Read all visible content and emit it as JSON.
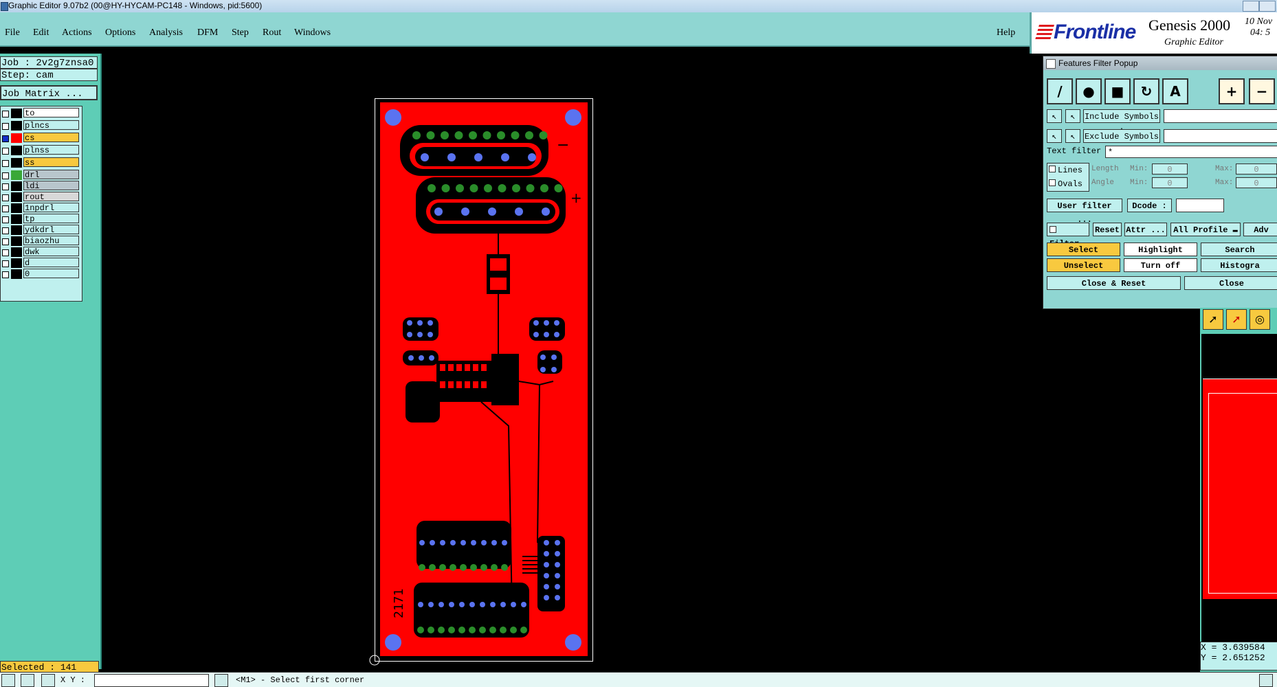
{
  "window": {
    "title": "Graphic Editor 9.07b2 (00@HY-HYCAM-PC148 - Windows, pid:5600)"
  },
  "menu": {
    "items": [
      "File",
      "Edit",
      "Actions",
      "Options",
      "Analysis",
      "DFM",
      "Step",
      "Rout",
      "Windows"
    ],
    "help": "Help"
  },
  "brand": {
    "logo": "Frontline",
    "product": "Genesis 2000",
    "subtitle": "Graphic Editor",
    "date": "10 Nov",
    "time": "04: 5"
  },
  "job": {
    "job_label": "Job : 2v2g7znsa0",
    "step_label": "Step: cam",
    "matrix_button": "Job Matrix ..."
  },
  "layers": [
    {
      "name": "to",
      "swatch": "#000000",
      "bg": "#ffffff"
    },
    {
      "name": "plncs",
      "swatch": "#000000",
      "bg": "#bff0ee"
    },
    {
      "name": "cs",
      "swatch": "#ff0000",
      "bg": "#f8c93f",
      "active": true
    },
    {
      "name": "plnss",
      "swatch": "#000000",
      "bg": "#bff0ee"
    },
    {
      "name": "ss",
      "swatch": "#000000",
      "bg": "#f8c93f"
    },
    {
      "name": "drl",
      "swatch": "#3aa837",
      "bg": "#b8c6cc"
    },
    {
      "name": "ldi",
      "swatch": "#000000",
      "bg": "#b8c6cc"
    },
    {
      "name": "rout",
      "swatch": "#000000",
      "bg": "#d8d8d8"
    },
    {
      "name": "1npdrl",
      "swatch": "#000000",
      "bg": "#bff0ee"
    },
    {
      "name": "tp",
      "swatch": "#000000",
      "bg": "#bff0ee"
    },
    {
      "name": "ydkdrl",
      "swatch": "#000000",
      "bg": "#bff0ee"
    },
    {
      "name": "biaozhu",
      "swatch": "#000000",
      "bg": "#bff0ee"
    },
    {
      "name": "dwk",
      "swatch": "#000000",
      "bg": "#bff0ee"
    },
    {
      "name": "d",
      "swatch": "#000000",
      "bg": "#bff0ee"
    },
    {
      "name": "0",
      "swatch": "#000000",
      "bg": "#bff0ee"
    }
  ],
  "status": {
    "selected": "Selected : 141",
    "xy_label": "X Y :",
    "prompt": "<M1> - Select first corner"
  },
  "board": {
    "label": "2171",
    "minus": "−",
    "plus": "+"
  },
  "popup": {
    "title": "Features Filter Popup",
    "include": "Include Symbols :",
    "exclude": "Exclude Symbols :",
    "text_filter": "Text filter",
    "text_filter_value": "*",
    "lines": "Lines",
    "ovals": "Ovals",
    "length": "Length",
    "angle": "Angle",
    "min": "Min:",
    "max": "Max:",
    "zero": "0",
    "user_filter": "User filter ...",
    "dcode": "Dcode :",
    "filter": "Filter",
    "reset": "Reset",
    "attr": "Attr ...",
    "all_profile": "All Profile",
    "adv": "Adv",
    "select": "Select",
    "highlight": "Highlight",
    "search": "Search",
    "unselect": "Unselect",
    "turn_off": "Turn off",
    "histogram": "Histogra",
    "close_reset": "Close & Reset",
    "close": "Close"
  },
  "coords": {
    "x": "X = 3.639584",
    "y": "Y = 2.651252"
  },
  "colors": {
    "accent": "#8fd6d2",
    "copper": "#ff0000",
    "pad": "#5a73f0",
    "drill": "#2a8d2a",
    "yellow": "#f8c93f"
  }
}
